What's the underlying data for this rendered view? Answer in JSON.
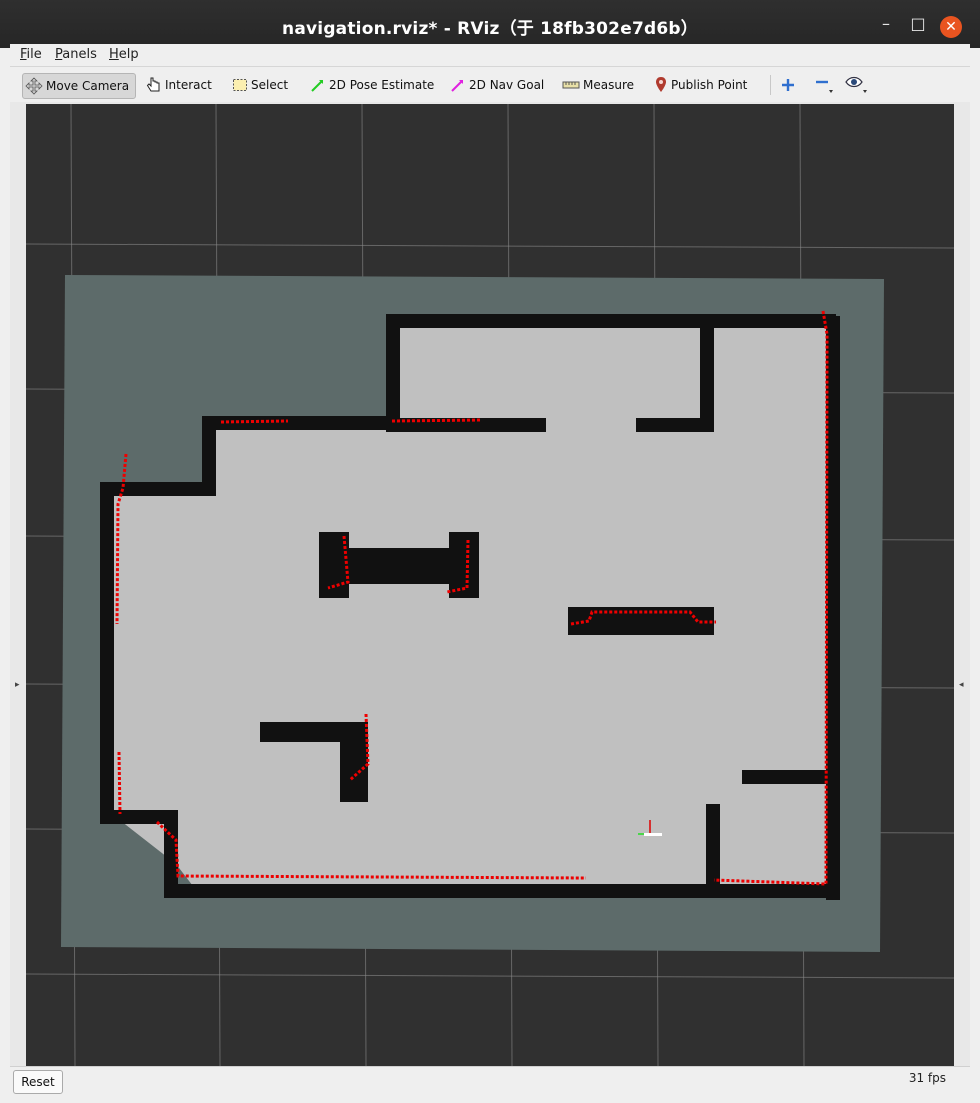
{
  "window": {
    "title": "navigation.rviz* - RViz（于 18fb302e7d6b）",
    "controls": {
      "minimize": "–",
      "maximize": "□",
      "close": "✕"
    }
  },
  "menu": {
    "items": [
      {
        "label": "File",
        "accel": "F",
        "rest": "ile"
      },
      {
        "label": "Panels",
        "accel": "P",
        "rest": "anels"
      },
      {
        "label": "Help",
        "accel": "H",
        "rest": "elp"
      }
    ]
  },
  "toolbar": {
    "tools": [
      {
        "label": "Move Camera",
        "icon": "move-camera-icon",
        "active": true
      },
      {
        "label": "Interact",
        "icon": "hand-pointer-icon"
      },
      {
        "label": "Select",
        "icon": "select-box-icon"
      },
      {
        "label": "2D Pose Estimate",
        "icon": "green-arrow-icon",
        "color": "#22cc22"
      },
      {
        "label": "2D Nav Goal",
        "icon": "magenta-arrow-icon",
        "color": "#e020e0"
      },
      {
        "label": "Measure",
        "icon": "ruler-icon"
      },
      {
        "label": "Publish Point",
        "icon": "map-pin-icon",
        "color": "#b03a2e"
      }
    ],
    "extra": [
      "zoom-in-icon",
      "zoom-out-icon",
      "eye-camera-icon"
    ]
  },
  "map": {
    "background": "#303030",
    "costmap_color": "#5d6b6a",
    "free_color": "#c0c0c0",
    "wall_color": "#111111",
    "laser_color": "#ee0000",
    "grid_color": "#8a8a8a"
  },
  "status": {
    "reset_label": "Reset",
    "fps": "31 fps"
  }
}
